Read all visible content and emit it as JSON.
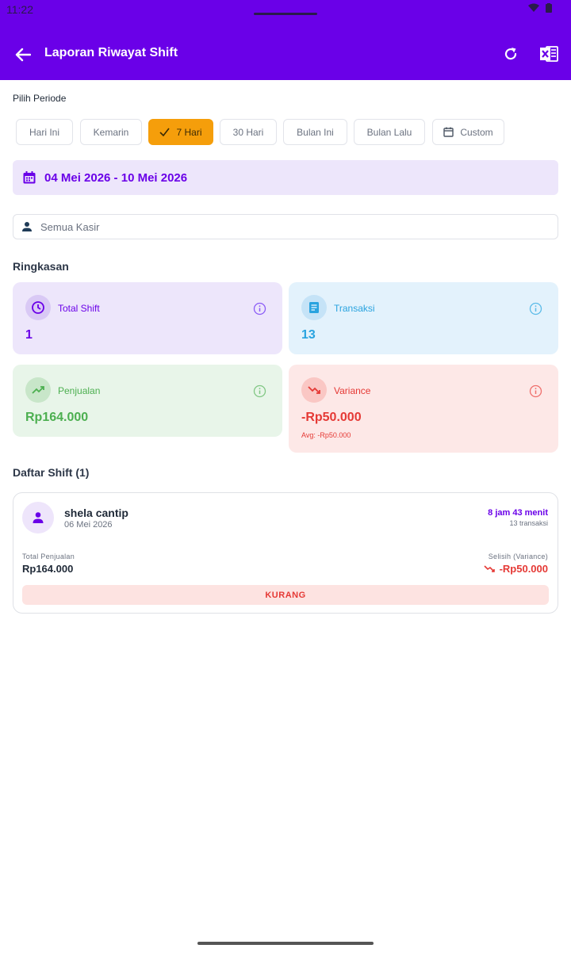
{
  "status_bar": {
    "time": "11:22"
  },
  "header": {
    "title": "Laporan Riwayat Shift"
  },
  "period": {
    "label": "Pilih Periode",
    "chips": [
      "Hari Ini",
      "Kemarin",
      "7 Hari",
      "30 Hari",
      "Bulan Ini",
      "Bulan Lalu",
      "Custom"
    ],
    "selected": "7 Hari",
    "date_range": "04 Mei 2026 - 10 Mei 2026"
  },
  "kasir_filter": {
    "value": "Semua Kasir"
  },
  "summary": {
    "title": "Ringkasan",
    "total_shift": {
      "label": "Total Shift",
      "value": "1"
    },
    "transaksi": {
      "label": "Transaksi",
      "value": "13"
    },
    "penjualan": {
      "label": "Penjualan",
      "value": "Rp164.000"
    },
    "variance": {
      "label": "Variance",
      "value": "-Rp50.000",
      "avg": "Avg: -Rp50.000"
    }
  },
  "shift_list": {
    "title": "Daftar Shift (1)",
    "items": [
      {
        "name": "shela cantip",
        "date": "06 Mei 2026",
        "duration": "8 jam 43 menit",
        "transactions": "13 transaksi",
        "sales_label": "Total Penjualan",
        "sales_value": "Rp164.000",
        "variance_label": "Selisih (Variance)",
        "variance_value": "-Rp50.000",
        "status": "KURANG"
      }
    ]
  },
  "colors": {
    "primary": "#6a00e8",
    "accent": "#f59e0b",
    "success": "#4caf50",
    "info": "#29a3df",
    "danger": "#e53935"
  }
}
